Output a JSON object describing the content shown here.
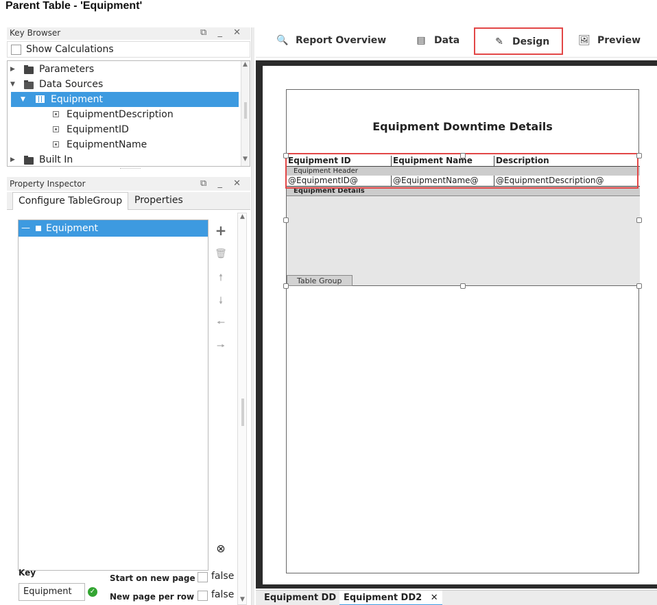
{
  "caption": "Parent Table - 'Equipment'",
  "key_browser": {
    "title": "Key Browser",
    "show_calculations": "Show Calculations",
    "tree": [
      {
        "label": "Parameters"
      },
      {
        "label": "Data Sources"
      },
      {
        "label": "Equipment"
      },
      {
        "label": "EquipmentDescription"
      },
      {
        "label": "EquipmentID"
      },
      {
        "label": "EquipmentName"
      },
      {
        "label": "Built In"
      }
    ]
  },
  "property_inspector": {
    "title": "Property Inspector",
    "tabs": [
      "Configure TableGroup",
      "Properties"
    ],
    "selected_item": "Equipment",
    "key_label": "Key",
    "key_value": "Equipment",
    "start_new_page_label": "Start on new page",
    "start_new_page_value": "false",
    "new_page_per_row_label": "New page per row",
    "new_page_per_row_value": "false"
  },
  "top_tabs": [
    "Report Overview",
    "Data",
    "Design",
    "Preview"
  ],
  "report": {
    "title": "Equipment Downtime Details",
    "headers": [
      "Equipment ID",
      "Equipment Name",
      "Description"
    ],
    "header_band": "Equipment Header",
    "fields": [
      "@EquipmentID@",
      "@EquipmentName@",
      "@EquipmentDescription@"
    ],
    "details_band": "Equipment Details",
    "table_group_label": "Table Group"
  },
  "doc_tabs": [
    "Equipment DD",
    "Equipment DD2"
  ],
  "colors": {
    "selection": "#3d9ae0",
    "highlight_box": "#e24646"
  }
}
